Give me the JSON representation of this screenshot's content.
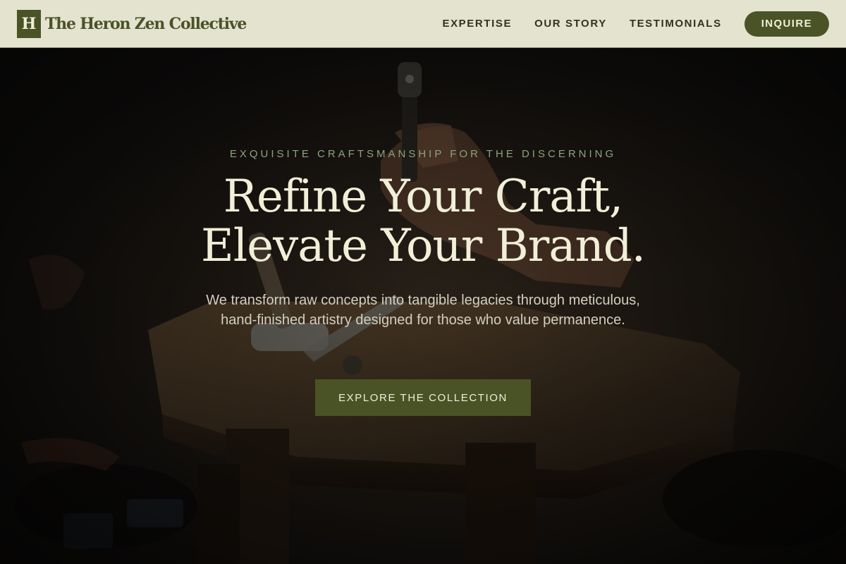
{
  "header": {
    "logo_mark": "H",
    "brand_name": "The Heron Zen Collective",
    "nav": [
      {
        "label": "EXPERTISE"
      },
      {
        "label": "OUR STORY"
      },
      {
        "label": "TESTIMONIALS"
      }
    ],
    "cta_label": "INQUIRE"
  },
  "hero": {
    "eyebrow": "EXQUISITE CRAFTSMANSHIP FOR THE DISCERNING",
    "headline_line1": "Refine Your Craft,",
    "headline_line2": "Elevate Your Brand.",
    "subtext": "We transform raw concepts into tangible legacies through meticulous, hand-finished artistry designed for those who value permanence.",
    "cta_label": "EXPLORE THE COLLECTION",
    "background_image": "craftsman-workbench-photo"
  },
  "colors": {
    "header_bg": "#e4e3d0",
    "brand_green": "#4a5326",
    "cream_text": "#f1efd8",
    "eyebrow_green": "#8ea27c",
    "hero_dark": "#161412"
  }
}
